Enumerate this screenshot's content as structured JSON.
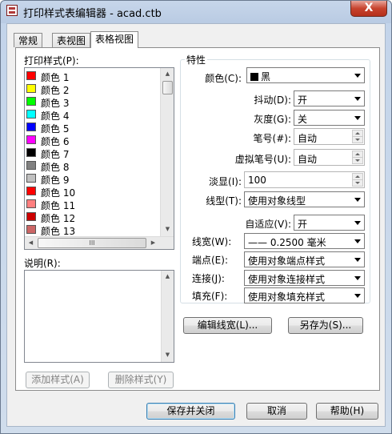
{
  "window": {
    "title": "打印样式表编辑器 - acad.ctb",
    "close_label": "X"
  },
  "tabs": [
    {
      "label": "常规"
    },
    {
      "label": "表视图"
    },
    {
      "label": "表格视图"
    }
  ],
  "styles_list": {
    "label": "打印样式(P):",
    "items": [
      {
        "label": "颜色  1",
        "color": "#ff0000"
      },
      {
        "label": "颜色  2",
        "color": "#ffff00"
      },
      {
        "label": "颜色  3",
        "color": "#00ff00"
      },
      {
        "label": "颜色  4",
        "color": "#00ffff"
      },
      {
        "label": "颜色  5",
        "color": "#0000ff"
      },
      {
        "label": "颜色  6",
        "color": "#ff00ff"
      },
      {
        "label": "颜色  7",
        "color": "#000000"
      },
      {
        "label": "颜色  8",
        "color": "#808080"
      },
      {
        "label": "颜色  9",
        "color": "#c0c0c0"
      },
      {
        "label": "颜色  10",
        "color": "#ff0000"
      },
      {
        "label": "颜色  11",
        "color": "#ff7f7f"
      },
      {
        "label": "颜色  12",
        "color": "#cc0000"
      },
      {
        "label": "颜色  13",
        "color": "#cc6666"
      }
    ],
    "hscroll_grip": "III"
  },
  "description": {
    "label": "说明(R):",
    "value": ""
  },
  "buttons": {
    "add_style": "添加样式(A)",
    "delete_style": "删除样式(Y)",
    "edit_lineweights": "编辑线宽(L)...",
    "save_as": "另存为(S)...",
    "save_close": "保存并关闭",
    "cancel": "取消",
    "help": "帮助(H)"
  },
  "properties": {
    "group_label": "特性",
    "color": {
      "label": "颜色(C):",
      "value": "黑"
    },
    "dither": {
      "label": "抖动(D):",
      "value": "开"
    },
    "grayscale": {
      "label": "灰度(G):",
      "value": "关"
    },
    "pen_number": {
      "label": "笔号(#):",
      "value": "自动"
    },
    "virtual_pen": {
      "label": "虚拟笔号(U):",
      "value": "自动"
    },
    "screening": {
      "label": "淡显(I):",
      "value": "100"
    },
    "linetype": {
      "label": "线型(T):",
      "value": "使用对象线型"
    },
    "adaptive": {
      "label": "自适应(V):",
      "value": "开"
    },
    "lineweight": {
      "label": "线宽(W):",
      "value": "—— 0.2500 毫米"
    },
    "line_end": {
      "label": "端点(E):",
      "value": "使用对象端点样式"
    },
    "line_join": {
      "label": "连接(J):",
      "value": "使用对象连接样式"
    },
    "fill": {
      "label": "填充(F):",
      "value": "使用对象填充样式"
    }
  }
}
